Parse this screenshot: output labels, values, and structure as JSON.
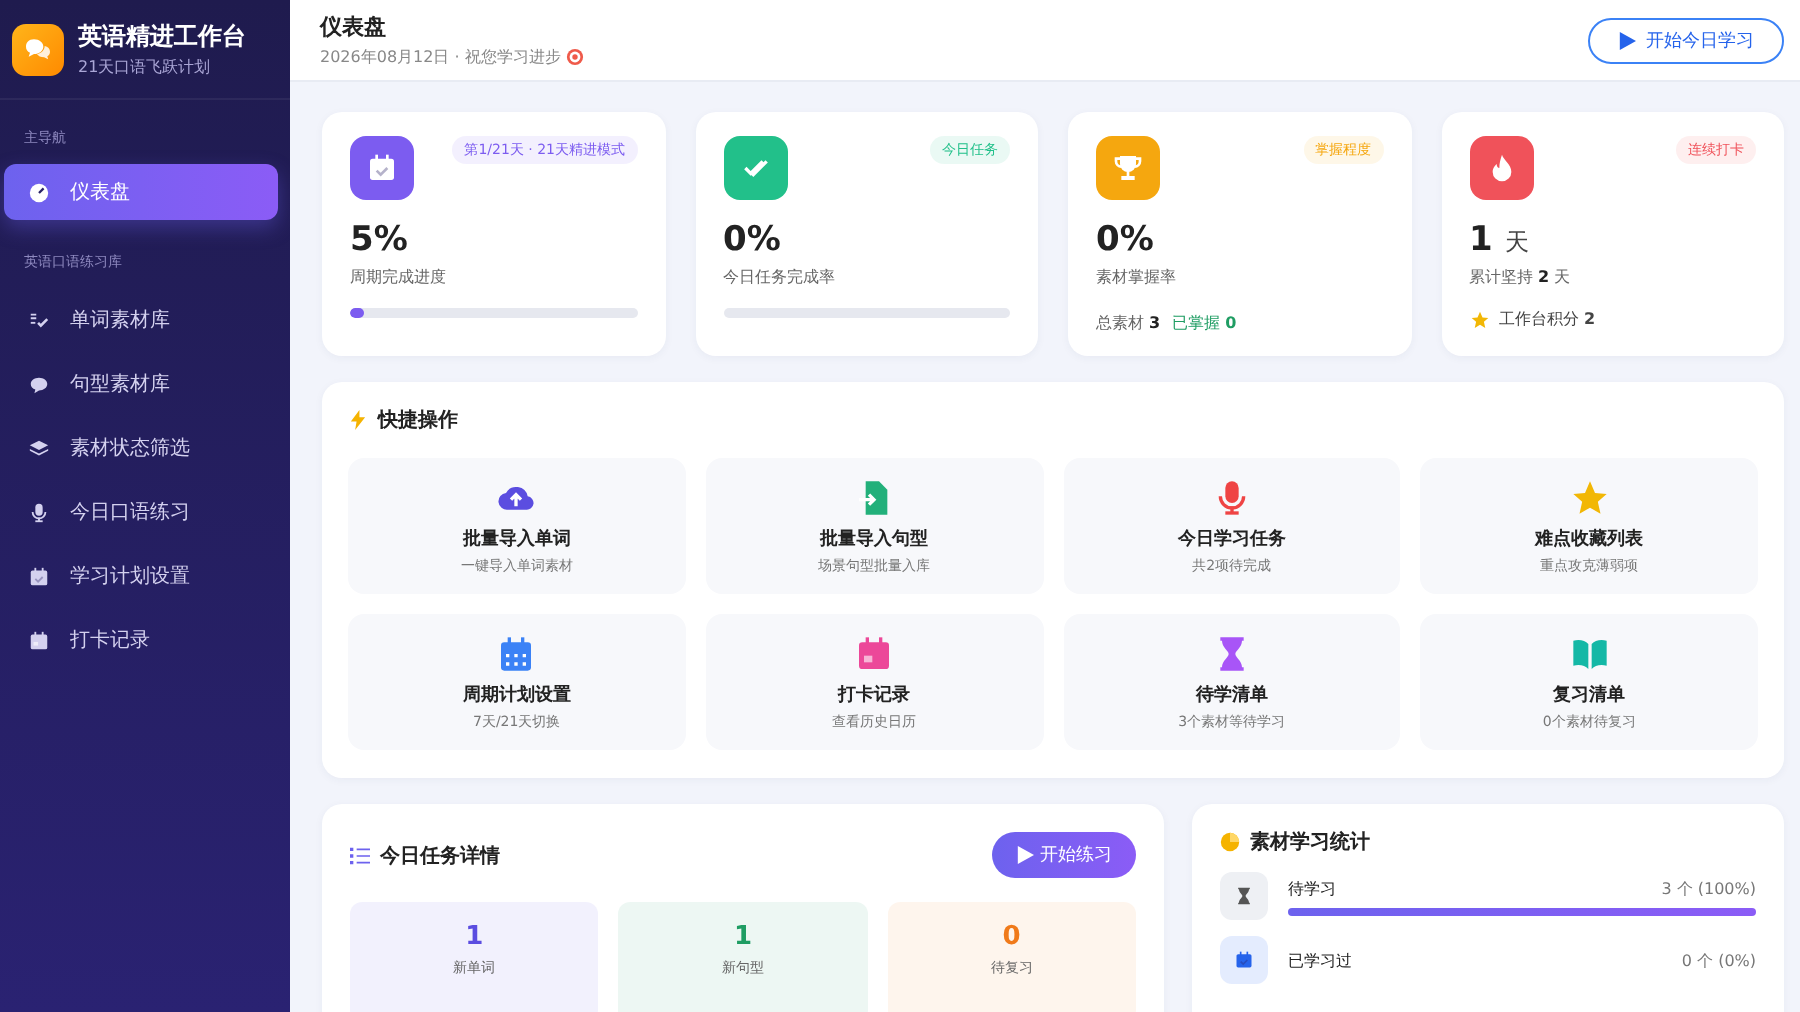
{
  "sidebar": {
    "app_title": "英语精进工作台",
    "app_subtitle": "21天口语飞跃计划",
    "sections": [
      {
        "heading": "主导航",
        "items": [
          {
            "kind": "gauge",
            "label": "仪表盘",
            "selected": true
          }
        ]
      },
      {
        "heading": "英语口语练习库",
        "items": [
          {
            "kind": "spell",
            "label": "单词素材库",
            "selected": false
          },
          {
            "kind": "chat",
            "label": "句型素材库",
            "selected": false
          },
          {
            "kind": "layers",
            "label": "素材状态筛选",
            "selected": false
          },
          {
            "kind": "mic",
            "label": "今日口语练习",
            "selected": false
          },
          {
            "kind": "calcheck",
            "label": "学习计划设置",
            "selected": false
          },
          {
            "kind": "calendar",
            "label": "打卡记录",
            "selected": false
          }
        ]
      }
    ]
  },
  "header": {
    "title": "仪表盘",
    "subtitle": "2026年08月12日 · 祝您学习进步",
    "button": "开始今日学习"
  },
  "stat_cards": [
    {
      "kind": "progress",
      "color": "#7c5cf0",
      "badge": "第1/21天 · 21天精进模式",
      "value": "5%",
      "label": "周期完成进度",
      "level": 0.05
    },
    {
      "kind": "progress",
      "color": "#22c08a",
      "badge": "今日任务",
      "value": "0%",
      "label": "今日任务完成率",
      "level": 0
    },
    {
      "kind": "details",
      "color": "#f5a70f",
      "badge": "掌握程度",
      "value": "0%",
      "label": "素材掌握率",
      "details": [
        "总素材 **3**",
        "已掌握 **0**"
      ]
    },
    {
      "kind": "streak",
      "color": "#f0525a",
      "badge": "连续打卡",
      "value": "1",
      "unit": "天",
      "label": "累计坚持 **2** 天",
      "note": "工作台积分 **2**"
    }
  ],
  "quick_actions": {
    "title": "快捷操作",
    "items": [
      {
        "kind": "cloud",
        "color": "#5b4de0",
        "title": "批量导入单词",
        "subtitle": "一键导入单词素材"
      },
      {
        "kind": "fileimport",
        "color": "#22b07a",
        "title": "批量导入句型",
        "subtitle": "场景句型批量入库"
      },
      {
        "kind": "mic",
        "color": "#ef4444",
        "title": "今日学习任务",
        "subtitle": "共2项待完成"
      },
      {
        "kind": "star",
        "color": "#f2b705",
        "title": "难点收藏列表",
        "subtitle": "重点攻克薄弱项"
      },
      {
        "kind": "calgrid",
        "color": "#3b82f6",
        "title": "周期计划设置",
        "subtitle": "7天/21天切换"
      },
      {
        "kind": "calendar",
        "color": "#ec4899",
        "title": "打卡记录",
        "subtitle": "查看历史日历"
      },
      {
        "kind": "hourglass",
        "color": "#a855f7",
        "title": "待学清单",
        "subtitle": "3个素材等待学习"
      },
      {
        "kind": "book",
        "color": "#14b8a6",
        "title": "复习清单",
        "subtitle": "0个素材待复习"
      }
    ]
  },
  "task_details": {
    "title": "今日任务详情",
    "button": "开始练习",
    "tiles": [
      {
        "value": "1",
        "label": "新单词",
        "color": "#5b4de0"
      },
      {
        "value": "1",
        "label": "新句型",
        "color": "#1f9d63"
      },
      {
        "value": "0",
        "label": "待复习",
        "color": "#f07a1a"
      }
    ]
  },
  "material_stats": {
    "title": "素材学习统计",
    "rows": [
      {
        "kind": "hourglass",
        "label": "待学习",
        "reading": "3 个 (100%)",
        "level": 1
      },
      {
        "kind": "calcheck",
        "label": "已学习过",
        "reading": "0 个 (0%)"
      }
    ]
  }
}
